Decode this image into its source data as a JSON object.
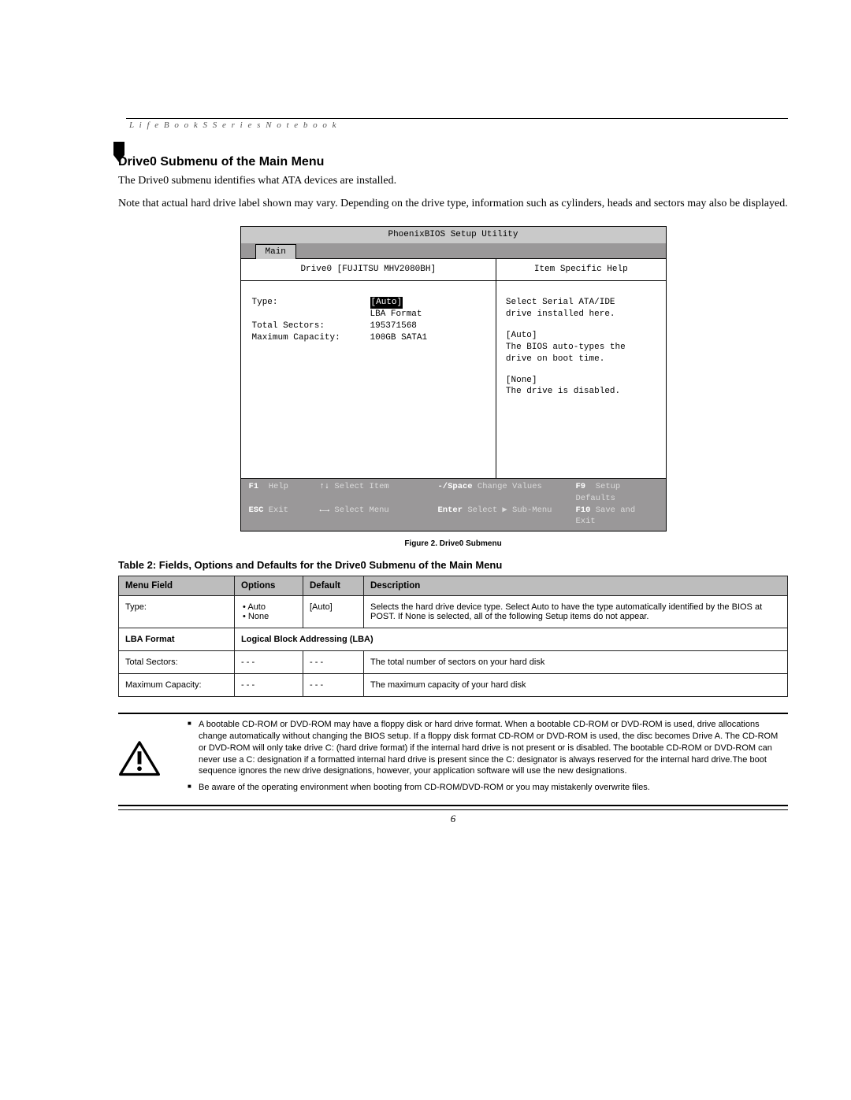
{
  "header": {
    "running_header": "L i f e B o o k   S   S e r i e s   N o t e b o o k",
    "title": "Drive0 Submenu of the Main Menu",
    "intro_1": "The Drive0 submenu identifies what ATA devices are installed.",
    "intro_2": "Note that actual hard drive label shown may vary. Depending on the drive type, information such as cylinders, heads and sectors may also be displayed."
  },
  "bios": {
    "utility_title": "PhoenixBIOS Setup Utility",
    "tab": "Main",
    "left_header": "Drive0 [FUJITSU MHV2080BH]",
    "right_header": "Item Specific Help",
    "fields": {
      "type_label": "Type:",
      "type_value": "[Auto]",
      "lba_label": "LBA Format",
      "sectors_label": "Total Sectors:",
      "sectors_value": "195371568",
      "capacity_label": "Maximum Capacity:",
      "capacity_value": "100GB SATA1"
    },
    "help": {
      "l1": "Select Serial ATA/IDE",
      "l2": "drive installed here.",
      "l3": "[Auto]",
      "l4": "The BIOS auto-types the",
      "l5": "drive on boot time.",
      "l6": "[None]",
      "l7": "The drive is disabled."
    },
    "footer": {
      "f1_key": "F1",
      "f1_label": "Help",
      "arrows_v": "↑↓",
      "arrows_v_label": "Select Item",
      "space_key": "-/Space",
      "space_label": "Change Values",
      "f9_key": "F9",
      "f9_label": "Setup Defaults",
      "esc_key": "ESC",
      "esc_label": "Exit",
      "arrows_h": "←→",
      "arrows_h_label": "Select Menu",
      "enter_key": "Enter",
      "enter_label": "Select ▶ Sub-Menu",
      "f10_key": "F10",
      "f10_label": "Save and Exit"
    }
  },
  "figure_caption": "Figure 2.   Drive0 Submenu",
  "table": {
    "title": "Table 2: Fields, Options and Defaults for the Drive0 Submenu of the Main Menu",
    "headers": {
      "h1": "Menu Field",
      "h2": "Options",
      "h3": "Default",
      "h4": "Description"
    },
    "row1": {
      "field": "Type:",
      "opt1": "Auto",
      "opt2": "None",
      "def": "[Auto]",
      "desc": "Selects the hard drive device type. Select Auto to have the type automatically identified by the BIOS at POST. If None is selected, all of the following Setup items do not appear."
    },
    "row2": {
      "field": "LBA Format",
      "desc": "Logical Block Addressing (LBA)"
    },
    "row3": {
      "field": "Total Sectors:",
      "opt": "- - -",
      "def": "- - -",
      "desc": "The total number of sectors on your hard disk"
    },
    "row4": {
      "field": "Maximum Capacity:",
      "opt": "- - -",
      "def": "- - -",
      "desc": "The maximum capacity of your hard disk"
    }
  },
  "warning": {
    "li1": "A bootable CD-ROM or DVD-ROM may have a floppy disk or hard drive format. When a bootable CD-ROM or DVD-ROM is used, drive allocations change automatically without changing the BIOS setup. If a floppy disk format CD-ROM or DVD-ROM is used, the disc becomes Drive A. The CD-ROM or DVD-ROM will only take drive C: (hard drive format) if the internal hard drive is not present or is disabled. The bootable CD-ROM or DVD-ROM can never use a C: designation if a formatted internal hard drive is present since the C: designator is always reserved for the internal hard drive.The boot sequence ignores the new drive designations, however, your application software will use the new designations.",
    "li2": "Be aware of the operating environment when booting from CD-ROM/DVD-ROM or you may mistakenly overwrite files."
  },
  "page_number": "6"
}
